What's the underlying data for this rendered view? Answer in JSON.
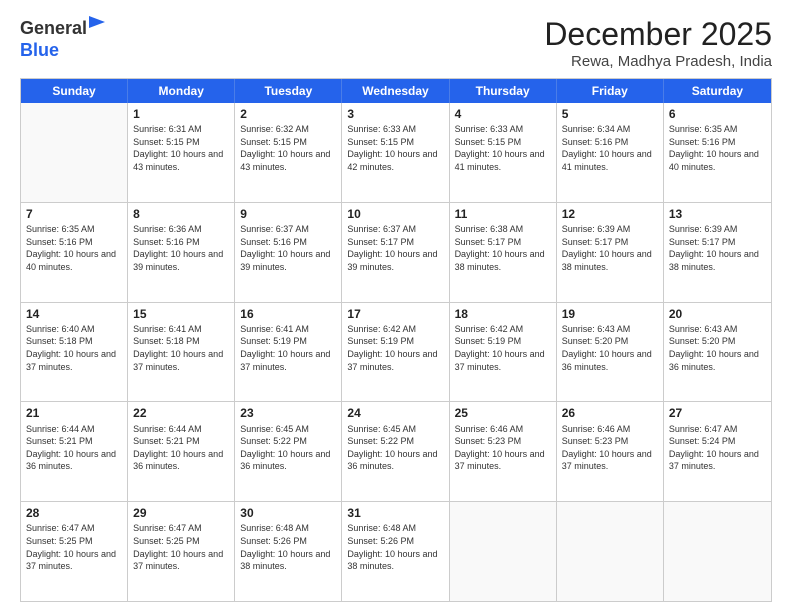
{
  "logo": {
    "line1": "General",
    "line2": "Blue"
  },
  "title": "December 2025",
  "location": "Rewa, Madhya Pradesh, India",
  "header_days": [
    "Sunday",
    "Monday",
    "Tuesday",
    "Wednesday",
    "Thursday",
    "Friday",
    "Saturday"
  ],
  "rows": [
    [
      {
        "day": "",
        "sunrise": "",
        "sunset": "",
        "daylight": ""
      },
      {
        "day": "1",
        "sunrise": "Sunrise: 6:31 AM",
        "sunset": "Sunset: 5:15 PM",
        "daylight": "Daylight: 10 hours and 43 minutes."
      },
      {
        "day": "2",
        "sunrise": "Sunrise: 6:32 AM",
        "sunset": "Sunset: 5:15 PM",
        "daylight": "Daylight: 10 hours and 43 minutes."
      },
      {
        "day": "3",
        "sunrise": "Sunrise: 6:33 AM",
        "sunset": "Sunset: 5:15 PM",
        "daylight": "Daylight: 10 hours and 42 minutes."
      },
      {
        "day": "4",
        "sunrise": "Sunrise: 6:33 AM",
        "sunset": "Sunset: 5:15 PM",
        "daylight": "Daylight: 10 hours and 41 minutes."
      },
      {
        "day": "5",
        "sunrise": "Sunrise: 6:34 AM",
        "sunset": "Sunset: 5:16 PM",
        "daylight": "Daylight: 10 hours and 41 minutes."
      },
      {
        "day": "6",
        "sunrise": "Sunrise: 6:35 AM",
        "sunset": "Sunset: 5:16 PM",
        "daylight": "Daylight: 10 hours and 40 minutes."
      }
    ],
    [
      {
        "day": "7",
        "sunrise": "Sunrise: 6:35 AM",
        "sunset": "Sunset: 5:16 PM",
        "daylight": "Daylight: 10 hours and 40 minutes."
      },
      {
        "day": "8",
        "sunrise": "Sunrise: 6:36 AM",
        "sunset": "Sunset: 5:16 PM",
        "daylight": "Daylight: 10 hours and 39 minutes."
      },
      {
        "day": "9",
        "sunrise": "Sunrise: 6:37 AM",
        "sunset": "Sunset: 5:16 PM",
        "daylight": "Daylight: 10 hours and 39 minutes."
      },
      {
        "day": "10",
        "sunrise": "Sunrise: 6:37 AM",
        "sunset": "Sunset: 5:17 PM",
        "daylight": "Daylight: 10 hours and 39 minutes."
      },
      {
        "day": "11",
        "sunrise": "Sunrise: 6:38 AM",
        "sunset": "Sunset: 5:17 PM",
        "daylight": "Daylight: 10 hours and 38 minutes."
      },
      {
        "day": "12",
        "sunrise": "Sunrise: 6:39 AM",
        "sunset": "Sunset: 5:17 PM",
        "daylight": "Daylight: 10 hours and 38 minutes."
      },
      {
        "day": "13",
        "sunrise": "Sunrise: 6:39 AM",
        "sunset": "Sunset: 5:17 PM",
        "daylight": "Daylight: 10 hours and 38 minutes."
      }
    ],
    [
      {
        "day": "14",
        "sunrise": "Sunrise: 6:40 AM",
        "sunset": "Sunset: 5:18 PM",
        "daylight": "Daylight: 10 hours and 37 minutes."
      },
      {
        "day": "15",
        "sunrise": "Sunrise: 6:41 AM",
        "sunset": "Sunset: 5:18 PM",
        "daylight": "Daylight: 10 hours and 37 minutes."
      },
      {
        "day": "16",
        "sunrise": "Sunrise: 6:41 AM",
        "sunset": "Sunset: 5:19 PM",
        "daylight": "Daylight: 10 hours and 37 minutes."
      },
      {
        "day": "17",
        "sunrise": "Sunrise: 6:42 AM",
        "sunset": "Sunset: 5:19 PM",
        "daylight": "Daylight: 10 hours and 37 minutes."
      },
      {
        "day": "18",
        "sunrise": "Sunrise: 6:42 AM",
        "sunset": "Sunset: 5:19 PM",
        "daylight": "Daylight: 10 hours and 37 minutes."
      },
      {
        "day": "19",
        "sunrise": "Sunrise: 6:43 AM",
        "sunset": "Sunset: 5:20 PM",
        "daylight": "Daylight: 10 hours and 36 minutes."
      },
      {
        "day": "20",
        "sunrise": "Sunrise: 6:43 AM",
        "sunset": "Sunset: 5:20 PM",
        "daylight": "Daylight: 10 hours and 36 minutes."
      }
    ],
    [
      {
        "day": "21",
        "sunrise": "Sunrise: 6:44 AM",
        "sunset": "Sunset: 5:21 PM",
        "daylight": "Daylight: 10 hours and 36 minutes."
      },
      {
        "day": "22",
        "sunrise": "Sunrise: 6:44 AM",
        "sunset": "Sunset: 5:21 PM",
        "daylight": "Daylight: 10 hours and 36 minutes."
      },
      {
        "day": "23",
        "sunrise": "Sunrise: 6:45 AM",
        "sunset": "Sunset: 5:22 PM",
        "daylight": "Daylight: 10 hours and 36 minutes."
      },
      {
        "day": "24",
        "sunrise": "Sunrise: 6:45 AM",
        "sunset": "Sunset: 5:22 PM",
        "daylight": "Daylight: 10 hours and 36 minutes."
      },
      {
        "day": "25",
        "sunrise": "Sunrise: 6:46 AM",
        "sunset": "Sunset: 5:23 PM",
        "daylight": "Daylight: 10 hours and 37 minutes."
      },
      {
        "day": "26",
        "sunrise": "Sunrise: 6:46 AM",
        "sunset": "Sunset: 5:23 PM",
        "daylight": "Daylight: 10 hours and 37 minutes."
      },
      {
        "day": "27",
        "sunrise": "Sunrise: 6:47 AM",
        "sunset": "Sunset: 5:24 PM",
        "daylight": "Daylight: 10 hours and 37 minutes."
      }
    ],
    [
      {
        "day": "28",
        "sunrise": "Sunrise: 6:47 AM",
        "sunset": "Sunset: 5:25 PM",
        "daylight": "Daylight: 10 hours and 37 minutes."
      },
      {
        "day": "29",
        "sunrise": "Sunrise: 6:47 AM",
        "sunset": "Sunset: 5:25 PM",
        "daylight": "Daylight: 10 hours and 37 minutes."
      },
      {
        "day": "30",
        "sunrise": "Sunrise: 6:48 AM",
        "sunset": "Sunset: 5:26 PM",
        "daylight": "Daylight: 10 hours and 38 minutes."
      },
      {
        "day": "31",
        "sunrise": "Sunrise: 6:48 AM",
        "sunset": "Sunset: 5:26 PM",
        "daylight": "Daylight: 10 hours and 38 minutes."
      },
      {
        "day": "",
        "sunrise": "",
        "sunset": "",
        "daylight": ""
      },
      {
        "day": "",
        "sunrise": "",
        "sunset": "",
        "daylight": ""
      },
      {
        "day": "",
        "sunrise": "",
        "sunset": "",
        "daylight": ""
      }
    ]
  ]
}
